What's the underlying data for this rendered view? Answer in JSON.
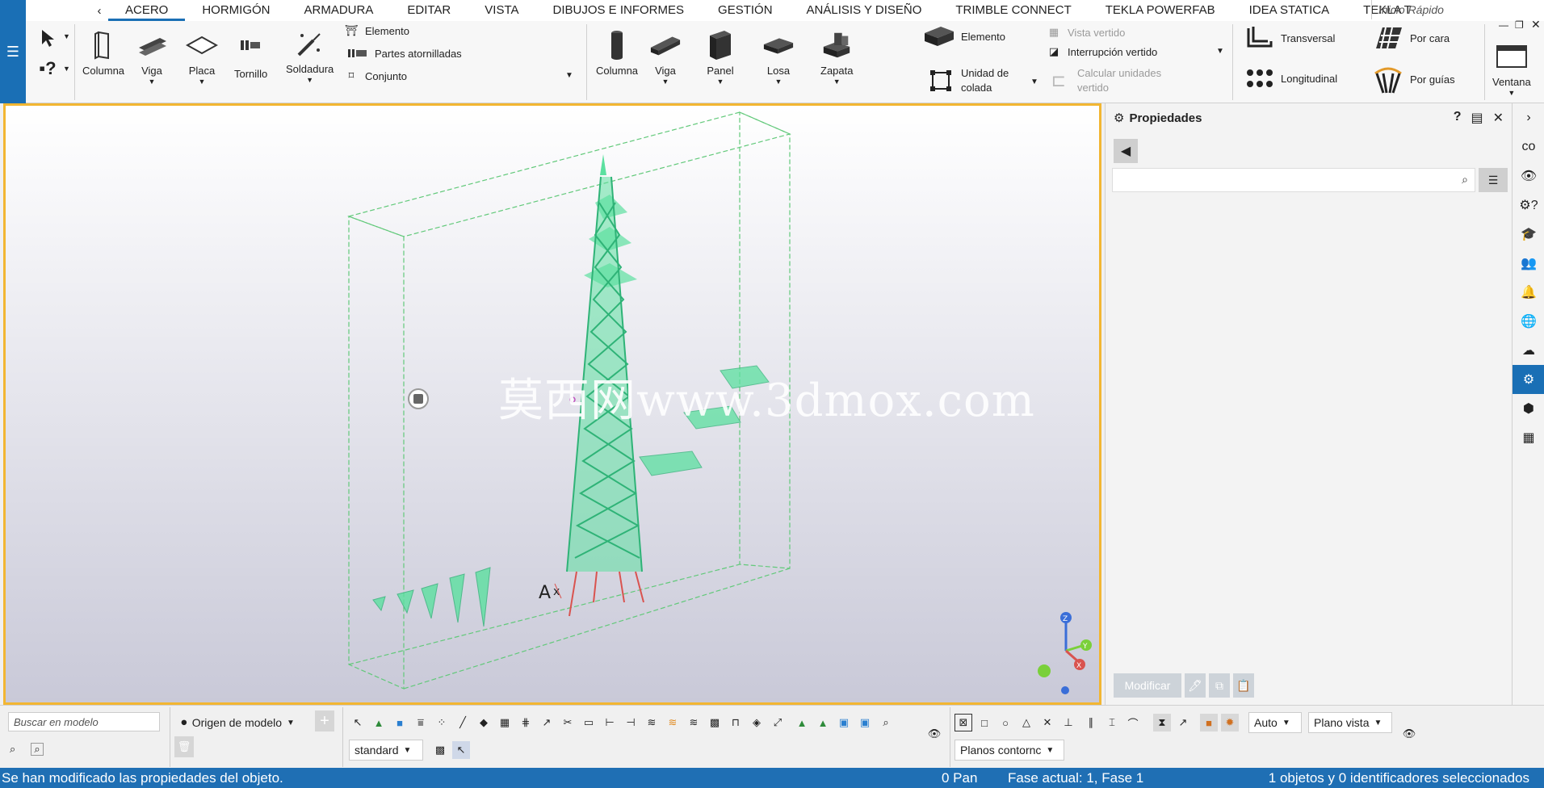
{
  "ribbon_tabs": [
    "ACERO",
    "HORMIGÓN",
    "ARMADURA",
    "EDITAR",
    "VISTA",
    "DIBUJOS E INFORMES",
    "GESTIÓN",
    "ANÁLISIS Y DISEÑO",
    "TRIMBLE CONNECT",
    "TEKLA POWERFAB",
    "IDEA STATICA",
    "TEKLA T"
  ],
  "quick_launch_placeholder": "Inicio Rápido",
  "steel": {
    "columna": "Columna",
    "viga": "Viga",
    "placa": "Placa",
    "tornillo": "Tornillo",
    "soldadura": "Soldadura",
    "elemento": "Elemento",
    "partes_atornilladas": "Partes atornilladas",
    "conjunto": "Conjunto"
  },
  "concrete": {
    "columna": "Columna",
    "viga": "Viga",
    "panel": "Panel",
    "losa": "Losa",
    "zapata": "Zapata",
    "elemento": "Elemento",
    "unidad_colada_1": "Unidad de",
    "unidad_colada_2": "colada",
    "vista_vertido": "Vista vertido",
    "interrupcion_vertido": "Interrupción vertido",
    "calcular_1": "Calcular unidades",
    "calcular_2": "vertido"
  },
  "rebar": {
    "transversal": "Transversal",
    "longitudinal": "Longitudinal",
    "por_cara": "Por cara",
    "por_guias": "Por guías"
  },
  "ventana": "Ventana",
  "watermark": "莫西网www.3dmox.com",
  "properties": {
    "title": "Propiedades",
    "modificar": "Modificar"
  },
  "bottom": {
    "search_placeholder": "Buscar en modelo",
    "origen": "Origen de modelo",
    "standard": "standard",
    "auto": "Auto",
    "plano_vista": "Plano vista",
    "planos_contorno": "Planos contornc"
  },
  "status": {
    "message": "Se han modificado las propiedades del objeto.",
    "pan": "0 Pan",
    "fase": "Fase actual: 1, Fase 1",
    "selection": "1 objetos y 0 identificadores seleccionados"
  },
  "colors": {
    "accent": "#1a6fb5",
    "viewport_border": "#f2b632",
    "tower": "#5ce0a0"
  }
}
